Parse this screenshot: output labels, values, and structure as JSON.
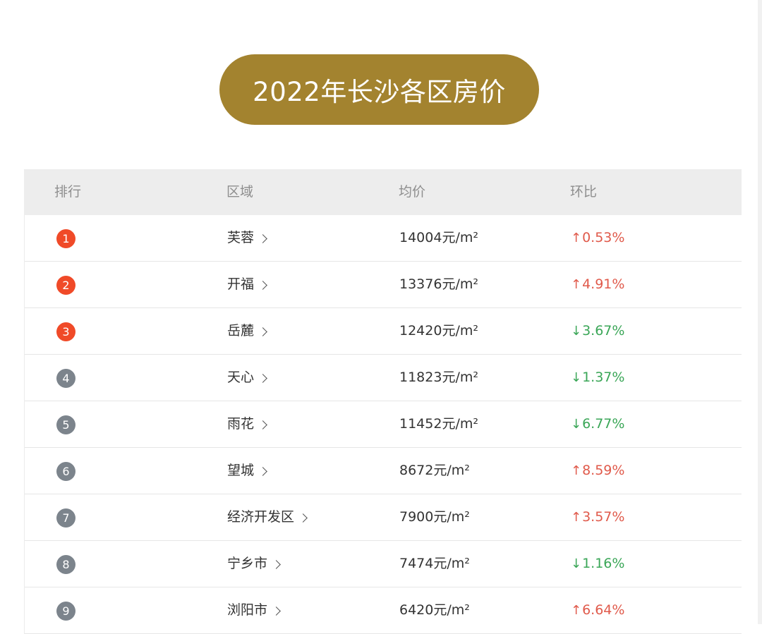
{
  "title": "2022年长沙各区房价",
  "table": {
    "headers": {
      "rank": "排行",
      "area": "区域",
      "price": "均价",
      "change": "环比"
    },
    "rows": [
      {
        "rank": "1",
        "area": "芙蓉",
        "price": "14004元/m²",
        "direction": "up",
        "change": "0.53%"
      },
      {
        "rank": "2",
        "area": "开福",
        "price": "13376元/m²",
        "direction": "up",
        "change": "4.91%"
      },
      {
        "rank": "3",
        "area": "岳麓",
        "price": "12420元/m²",
        "direction": "down",
        "change": "3.67%"
      },
      {
        "rank": "4",
        "area": "天心",
        "price": "11823元/m²",
        "direction": "down",
        "change": "1.37%"
      },
      {
        "rank": "5",
        "area": "雨花",
        "price": "11452元/m²",
        "direction": "down",
        "change": "6.77%"
      },
      {
        "rank": "6",
        "area": "望城",
        "price": "8672元/m²",
        "direction": "up",
        "change": "8.59%"
      },
      {
        "rank": "7",
        "area": "经济开发区",
        "price": "7900元/m²",
        "direction": "up",
        "change": "3.57%"
      },
      {
        "rank": "8",
        "area": "宁乡市",
        "price": "7474元/m²",
        "direction": "down",
        "change": "1.16%"
      },
      {
        "rank": "9",
        "area": "浏阳市",
        "price": "6420元/m²",
        "direction": "up",
        "change": "6.64%"
      }
    ]
  },
  "colors": {
    "title_bg": "#a3832f",
    "top_badge": "#f04a28",
    "rest_badge": "#7c848c",
    "up": "#e05a4b",
    "down": "#3aa657"
  }
}
